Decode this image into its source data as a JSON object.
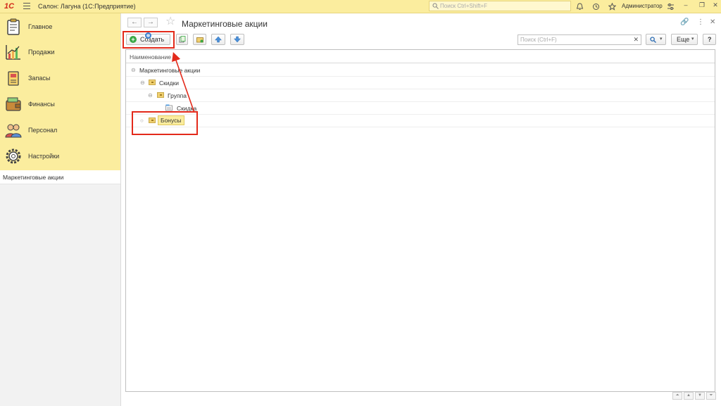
{
  "app": {
    "logo": "1С",
    "title": "Салон: Лагуна  (1С:Предприятие)",
    "search_placeholder": "Поиск Ctrl+Shift+F",
    "user": "Администратор"
  },
  "sidebar": {
    "sections": [
      {
        "label": "Главное",
        "icon": "clipboard-icon"
      },
      {
        "label": "Продажи",
        "icon": "sales-chart-icon"
      },
      {
        "label": "Запасы",
        "icon": "stock-icon"
      },
      {
        "label": "Финансы",
        "icon": "wallet-icon"
      },
      {
        "label": "Персонал",
        "icon": "people-icon"
      },
      {
        "label": "Настройки",
        "icon": "gear-icon"
      }
    ],
    "open_windows": [
      "Маркетинговые акции"
    ]
  },
  "form": {
    "title": "Маркетинговые акции",
    "toolbar": {
      "create_label": "Создать",
      "search_placeholder": "Поиск (Ctrl+F)",
      "more_label": "Еще",
      "help_label": "?"
    },
    "table": {
      "column": "Наименование",
      "rows": [
        {
          "text": "Маркетинговые акции",
          "level": 0,
          "type": "root",
          "expander": "⊖"
        },
        {
          "text": "Скидки",
          "level": 1,
          "type": "folder",
          "expander": "⊖"
        },
        {
          "text": "Группа",
          "level": 2,
          "type": "folder",
          "expander": "⊖"
        },
        {
          "text": "Скидка",
          "level": 3,
          "type": "item",
          "expander": ""
        },
        {
          "text": "Бонусы",
          "level": 1,
          "type": "folder",
          "expander": "○",
          "selected": true
        }
      ]
    }
  },
  "colors": {
    "accent_yellow": "#fbed9e",
    "annotation_red": "#e32a1b",
    "create_green": "#3aa846"
  }
}
